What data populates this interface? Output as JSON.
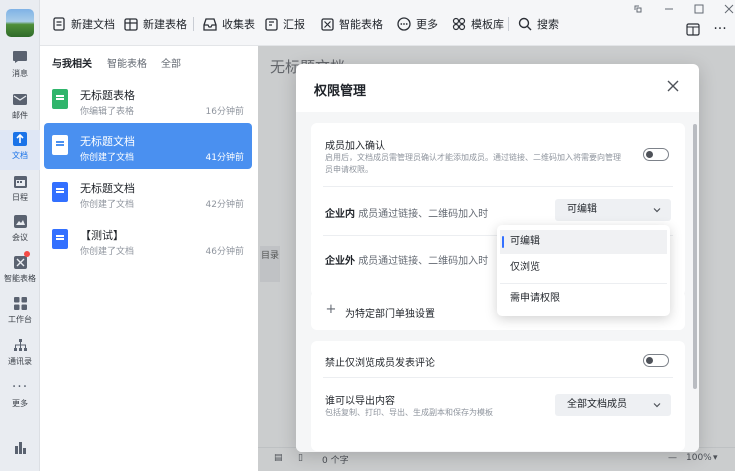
{
  "rail": {
    "items": [
      {
        "label": "消息",
        "icon": "chat-icon"
      },
      {
        "label": "邮件",
        "icon": "mail-icon"
      },
      {
        "label": "文档",
        "icon": "doc-icon"
      },
      {
        "label": "日程",
        "icon": "calendar-icon"
      },
      {
        "label": "会议",
        "icon": "meeting-icon"
      },
      {
        "label": "智能表格",
        "icon": "smart-table-icon"
      },
      {
        "label": "工作台",
        "icon": "workbench-icon"
      },
      {
        "label": "通讯录",
        "icon": "contacts-icon"
      },
      {
        "label": "更多",
        "icon": "more-dots-icon"
      }
    ]
  },
  "toolbar": {
    "new_doc": "新建文档",
    "new_sheet": "新建表格",
    "collect_form": "收集表",
    "report": "汇报",
    "smart_table": "智能表格",
    "more": "更多",
    "templates": "模板库",
    "search": "搜索"
  },
  "list": {
    "tabs": [
      "与我相关",
      "智能表格",
      "全部"
    ],
    "items": [
      {
        "title": "无标题表格",
        "sub": "你编辑了表格",
        "time": "16分钟前",
        "type": "sheet"
      },
      {
        "title": "无标题文档",
        "sub": "你创建了文档",
        "time": "41分钟前",
        "type": "doc"
      },
      {
        "title": "无标题文档",
        "sub": "你创建了文档",
        "time": "42分钟前",
        "type": "doc"
      },
      {
        "title": "【测试】",
        "sub": "你创建了文档",
        "time": "46分钟前",
        "type": "doc"
      }
    ]
  },
  "editor": {
    "title": "无标题文档",
    "toc": "目录",
    "word_count": "0 个字",
    "zoom": "100%"
  },
  "modal": {
    "title": "权限管理",
    "join_confirm_title": "成员加入确认",
    "join_confirm_desc": "启用后，文档成员需管理员确认才能添加成员。通过链接、二维码加入将需要向管理员申请权限。",
    "internal_label": "企业内",
    "internal_desc": "成员通过链接、二维码加入时",
    "internal_value": "可编辑",
    "external_label": "企业外",
    "external_desc": "成员通过链接、二维码加入时",
    "dept_setting": "为特定部门单独设置",
    "forbid_comment": "禁止仅浏览成员发表评论",
    "export_title": "谁可以导出内容",
    "export_desc": "包括复制、打印、导出、生成副本和保存为模板",
    "export_value": "全部文档成员"
  },
  "dropdown": {
    "options": [
      "可编辑",
      "仅浏览",
      "需申请权限"
    ],
    "selected": "可编辑"
  },
  "colors": {
    "accent": "#3370ff",
    "selected_row": "#4a90f0"
  }
}
